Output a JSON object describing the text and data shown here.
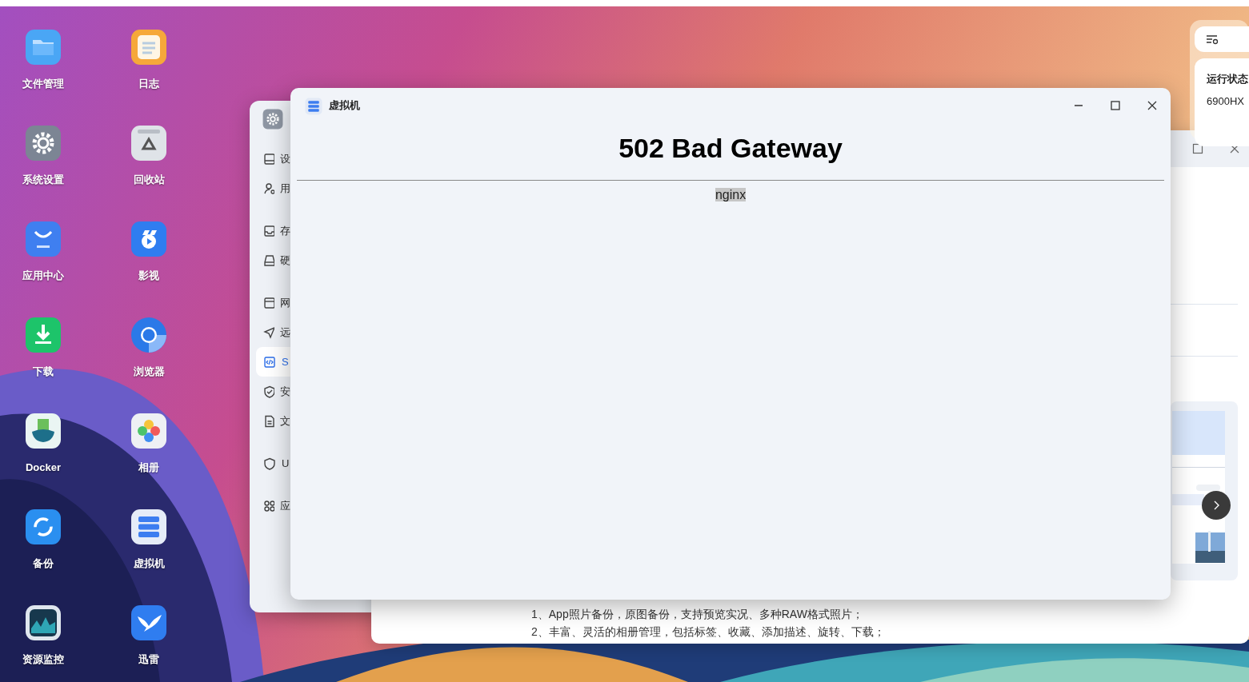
{
  "desktop_icons": [
    {
      "label": "文件管理"
    },
    {
      "label": "日志"
    },
    {
      "label": "系统设置"
    },
    {
      "label": "回收站"
    },
    {
      "label": "应用中心"
    },
    {
      "label": "影视"
    },
    {
      "label": "下载"
    },
    {
      "label": "浏览器"
    },
    {
      "label": "Docker"
    },
    {
      "label": "相册"
    },
    {
      "label": "备份"
    },
    {
      "label": "虚拟机"
    },
    {
      "label": "资源监控"
    },
    {
      "label": "迅雷"
    }
  ],
  "settings_window": {
    "sidebar": [
      {
        "items": [
          {
            "label": "设",
            "selected": false
          },
          {
            "label": "用",
            "selected": false
          }
        ]
      },
      {
        "items": [
          {
            "label": "存",
            "selected": false
          },
          {
            "label": "硬",
            "selected": false
          }
        ]
      },
      {
        "items": [
          {
            "label": "网",
            "selected": false
          },
          {
            "label": "远",
            "selected": false
          },
          {
            "label": "S",
            "selected": true
          },
          {
            "label": "安",
            "selected": false
          },
          {
            "label": "文",
            "selected": false
          }
        ]
      },
      {
        "items": [
          {
            "label": "U",
            "selected": false
          }
        ]
      },
      {
        "items": [
          {
            "label": "应",
            "selected": false
          }
        ]
      }
    ]
  },
  "photo_window": {
    "description_lines": [
      "1、App照片备份，原图备份，支持预览实况、多种RAW格式照片；",
      "2、丰富、灵活的相册管理，包括标签、收藏、添加描述、旋转、下载；"
    ]
  },
  "status_widget": {
    "title": "运行状态",
    "value": "6900HX"
  },
  "main_window": {
    "title": "虚拟机",
    "heading": "502 Bad Gateway",
    "server": "nginx",
    "server_highlighted": true
  }
}
